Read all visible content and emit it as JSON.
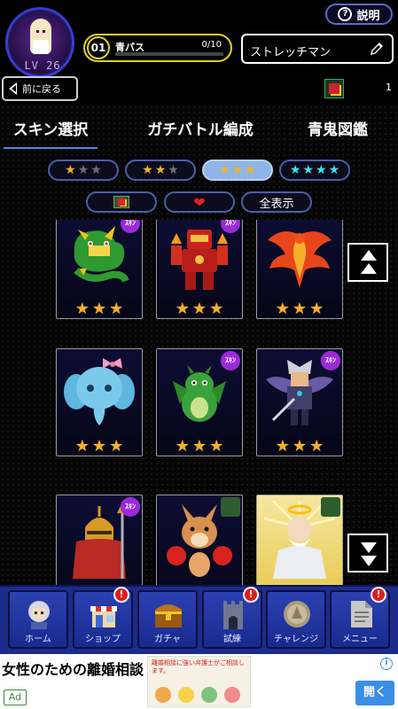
{
  "header": {
    "avatar_level": "LV 26",
    "help_label": "説明",
    "help_icon": "question-circle-icon",
    "pass": {
      "number": "01",
      "name": "青パス",
      "count": "0/10",
      "progress": 0.0
    },
    "player_name": "ストレッチマン",
    "edit_icon": "pencil-icon"
  },
  "back": {
    "label": "前に戻る",
    "icon": "back-triangle-icon",
    "item_count": "1"
  },
  "tabs": [
    {
      "label": "スキン選択",
      "active": true
    },
    {
      "label": "ガチバトル編成",
      "active": false
    },
    {
      "label": "青鬼図鑑",
      "active": false
    }
  ],
  "star_filters": [
    {
      "stars_gold": 1,
      "stars_grey": 2,
      "color": "#f2b12a",
      "selected": false
    },
    {
      "stars_gold": 2,
      "stars_grey": 1,
      "color": "#f2b12a",
      "selected": false
    },
    {
      "stars_gold": 3,
      "stars_grey": 0,
      "color": "#f2b12a",
      "selected": true
    },
    {
      "stars_gold": 4,
      "stars_grey": 0,
      "color": "#35e3ef",
      "selected": false
    }
  ],
  "type_filters": [
    {
      "icon": "item-box-icon",
      "label": ""
    },
    {
      "icon": "heart-icon",
      "label": ""
    },
    {
      "icon": "",
      "label": "全表示"
    }
  ],
  "cards": [
    {
      "character": "green-dragon",
      "stars": 3,
      "badge": "ｽｷﾝ"
    },
    {
      "character": "red-robot",
      "stars": 3,
      "badge": "ｽｷﾝ"
    },
    {
      "character": "phoenix",
      "stars": 3,
      "badge": ""
    },
    {
      "character": "blue-elephant",
      "stars": 3,
      "badge": ""
    },
    {
      "character": "green-baby-dragon",
      "stars": 3,
      "badge": "ｽｷﾝ"
    },
    {
      "character": "winged-warrior",
      "stars": 3,
      "badge": "ｽｷﾝ"
    },
    {
      "character": "golden-helmet-knight",
      "stars": 0,
      "badge": "ｽｷﾝ"
    },
    {
      "character": "boxing-kangaroo",
      "stars": 0,
      "badge": ""
    },
    {
      "character": "old-sage",
      "stars": 0,
      "badge": ""
    }
  ],
  "scroll": {
    "up_icon": "double-up-arrow-icon",
    "down_icon": "double-down-arrow-icon"
  },
  "nav": [
    {
      "label": "ホーム",
      "icon": "home-avatar-icon",
      "alert": false
    },
    {
      "label": "ショップ",
      "icon": "shop-icon",
      "alert": true
    },
    {
      "label": "ガチャ",
      "icon": "treasure-chest-icon",
      "alert": false
    },
    {
      "label": "試練",
      "icon": "tower-icon",
      "alert": true
    },
    {
      "label": "チャレンジ",
      "icon": "coin-icon",
      "alert": false
    },
    {
      "label": "メニュー",
      "icon": "document-icon",
      "alert": true
    }
  ],
  "nav_alert_mark": "!",
  "ad": {
    "title": "女性のための離婚相談",
    "badge": "Ad",
    "image_text": "離婚相談に強い弁護士がご相談します。",
    "open_label": "開く",
    "info_icon": "info-icon"
  }
}
